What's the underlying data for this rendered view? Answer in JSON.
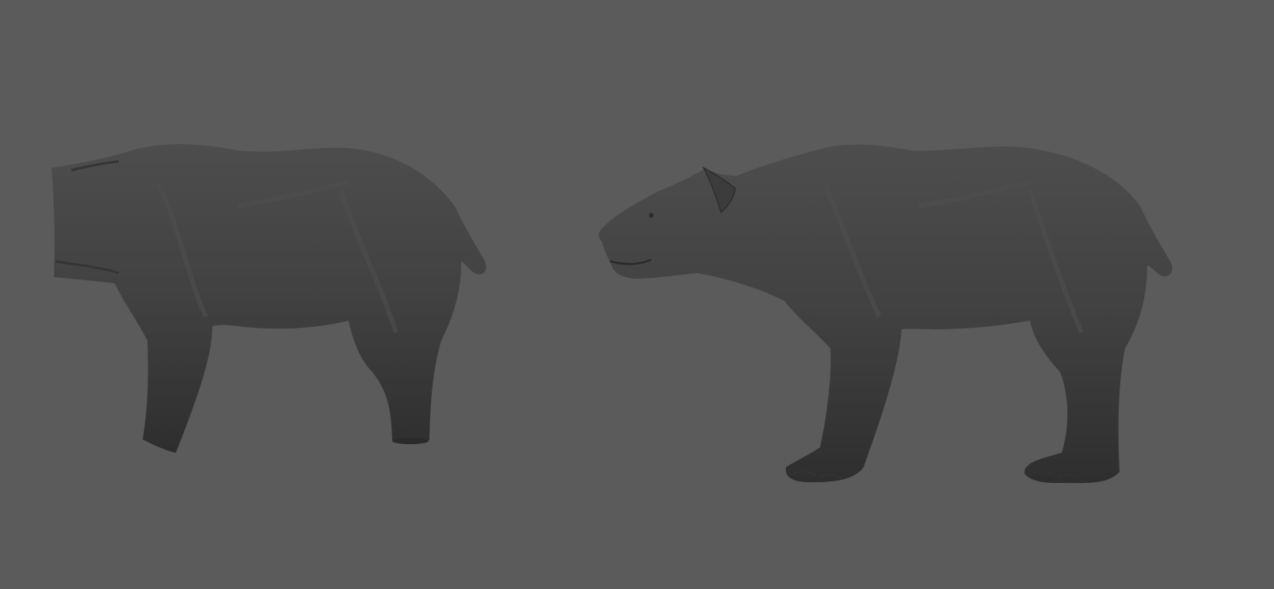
{
  "viewport": {
    "background_color": "#5b5b5b",
    "model_base_color": "#414141",
    "model_highlight_color": "#4d4d4d",
    "model_shadow_color": "#2e2e2e"
  },
  "models": [
    {
      "name": "bear-body-partial",
      "features": [
        "torso",
        "front-leg-stump",
        "hind-leg-stump",
        "tail"
      ]
    },
    {
      "name": "bear-full",
      "features": [
        "head",
        "ear",
        "torso",
        "front-leg",
        "hind-leg",
        "paws",
        "tail"
      ]
    }
  ]
}
